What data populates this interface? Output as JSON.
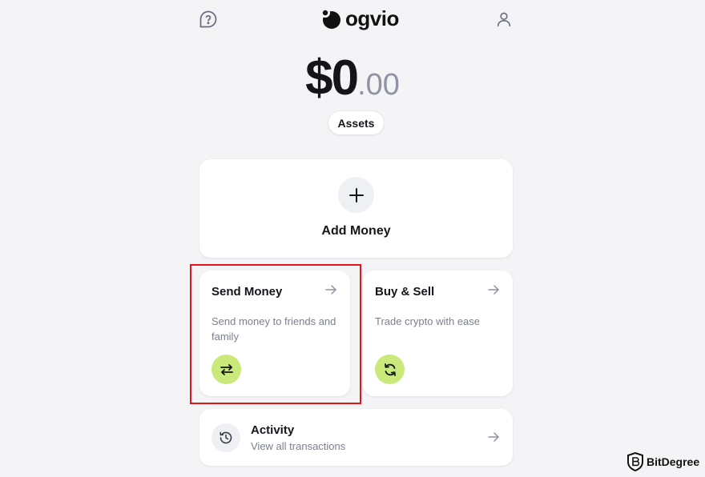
{
  "brand": {
    "logo_text": "ogvio"
  },
  "header": {
    "help_icon": "help-bubble-icon",
    "profile_icon": "user-icon"
  },
  "balance": {
    "whole": "$0",
    "cents": ".00"
  },
  "assets_button": {
    "label": "Assets"
  },
  "add_money": {
    "label": "Add Money",
    "icon": "plus-icon"
  },
  "cards": [
    {
      "title": "Send Money",
      "description": "Send money to friends and family",
      "icon": "swap-arrows-icon",
      "highlighted": true
    },
    {
      "title": "Buy & Sell",
      "description": "Trade crypto with ease",
      "icon": "refresh-icon",
      "highlighted": false
    }
  ],
  "activity": {
    "title": "Activity",
    "subtitle": "View all transactions",
    "icon": "history-icon"
  },
  "watermark": {
    "text": "BitDegree"
  },
  "colors": {
    "accent_green": "#c9ea7b",
    "highlight_red": "#e0161b",
    "background": "#f4f4f6"
  }
}
